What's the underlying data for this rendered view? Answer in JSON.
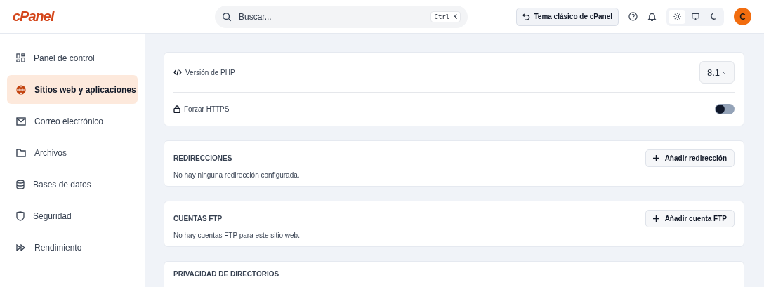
{
  "header": {
    "logo": "cPanel",
    "search": {
      "placeholder": "Buscar...",
      "shortcut": "Ctrl K"
    },
    "classic_button": "Tema clásico de cPanel",
    "theme_options": [
      {
        "kind": "light",
        "selected": true
      },
      {
        "kind": "system",
        "selected": false
      },
      {
        "kind": "dark",
        "selected": false
      }
    ],
    "avatar": "C"
  },
  "sidebar": {
    "items": [
      {
        "label": "Panel de control",
        "selected": false
      },
      {
        "label": "Sitios web y aplicaciones",
        "selected": true
      },
      {
        "label": "Correo electrónico",
        "selected": false
      },
      {
        "label": "Archivos",
        "selected": false
      },
      {
        "label": "Bases de datos",
        "selected": false
      },
      {
        "label": "Seguridad",
        "selected": false
      },
      {
        "label": "Rendimiento",
        "selected": false
      }
    ]
  },
  "settings": [
    {
      "kind": "select",
      "label": "Versión de PHP",
      "value": "8.1"
    },
    {
      "kind": "toggle",
      "label": "Forzar HTTPS",
      "on": false
    }
  ],
  "sections": [
    {
      "title": "REDIRECCIONES",
      "button": "Añadir redirección",
      "message": "No hay ninguna redirección configurada."
    },
    {
      "title": "CUENTAS FTP",
      "button": "Añadir cuenta FTP",
      "message": "No hay cuentas FTP para este sitio web."
    },
    {
      "title": "PRIVACIDAD DE DIRECTORIOS"
    }
  ]
}
